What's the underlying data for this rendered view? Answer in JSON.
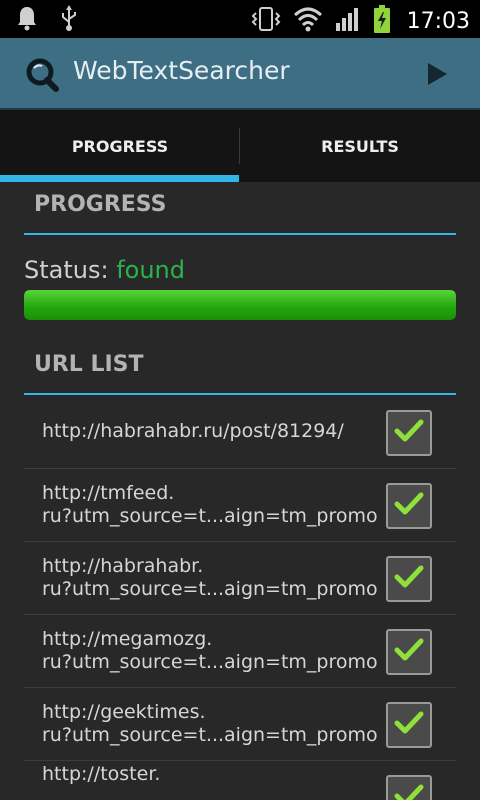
{
  "status_bar": {
    "icons": [
      "notification-bell-icon",
      "usb-icon",
      "vibrate-icon",
      "wifi-icon",
      "signal-icon",
      "battery-charging-icon"
    ],
    "time": "17:03"
  },
  "action_bar": {
    "title": "WebTextSearcher",
    "logo_icon": "search-logo-icon",
    "action_icon": "play-icon"
  },
  "tabs": [
    {
      "label": "PROGRESS",
      "selected": true
    },
    {
      "label": "RESULTS",
      "selected": false
    }
  ],
  "progress_section": {
    "header": "PROGRESS",
    "status_label": "Status:",
    "status_value": "found",
    "progress_percent": 100
  },
  "url_section": {
    "header": "URL LIST",
    "items": [
      {
        "lines": [
          "http://habrahabr.ru/post/81294/"
        ],
        "checked": true
      },
      {
        "lines": [
          "http://tmfeed.",
          "ru?utm_source=t...aign=tm_promo"
        ],
        "checked": true
      },
      {
        "lines": [
          "http://habrahabr.",
          "ru?utm_source=t...aign=tm_promo"
        ],
        "checked": true
      },
      {
        "lines": [
          "http://megamozg.",
          "ru?utm_source=t...aign=tm_promo"
        ],
        "checked": true
      },
      {
        "lines": [
          "http://geektimes.",
          "ru?utm_source=t...aign=tm_promo"
        ],
        "checked": true
      },
      {
        "lines": [
          "http://toster."
        ],
        "checked": true
      }
    ]
  },
  "colors": {
    "accent": "#33b5e5",
    "status_found": "#2bb24c",
    "action_bar": "#3d6e84",
    "progress": "#27a80e"
  }
}
